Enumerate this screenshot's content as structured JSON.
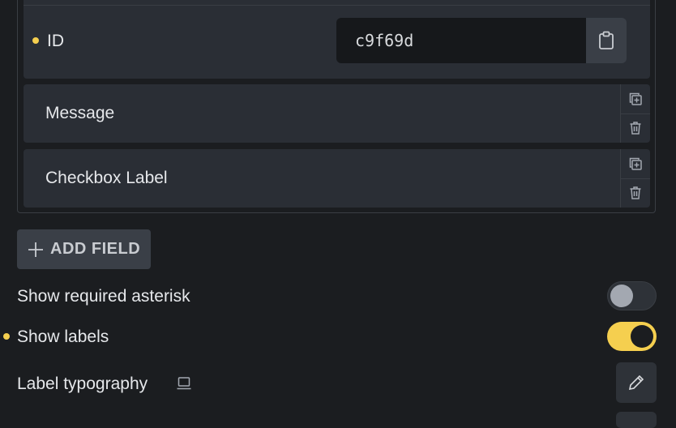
{
  "id_field": {
    "label": "ID",
    "value": "c9f69d",
    "modified": true
  },
  "fields": [
    {
      "label": "Message"
    },
    {
      "label": "Checkbox Label"
    }
  ],
  "add_field": {
    "label": "ADD FIELD"
  },
  "settings": {
    "show_required_asterisk": {
      "label": "Show required asterisk",
      "enabled": false
    },
    "show_labels": {
      "label": "Show labels",
      "enabled": true,
      "modified": true
    },
    "label_typography": {
      "label": "Label typography"
    }
  },
  "colors": {
    "accent": "#f5cf4f",
    "panel": "#2a2e35",
    "background": "#1b1d20"
  }
}
